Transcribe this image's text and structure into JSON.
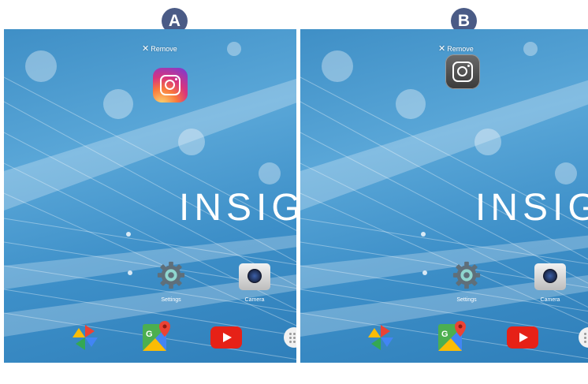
{
  "panels": [
    {
      "badge": "A",
      "remove_label": "Remove",
      "dragged_app_icon": "instagram-icon",
      "dragged_app_state": "color",
      "brand_text": "INSIG",
      "settings_label": "Settings",
      "camera_label": "Camera"
    },
    {
      "badge": "B",
      "remove_label": "Remove",
      "dragged_app_icon": "instagram-icon",
      "dragged_app_state": "grayed",
      "brand_text": "INSIG",
      "settings_label": "Settings",
      "camera_label": "Camera"
    }
  ],
  "dock_icons": [
    "pinwheel-photos-icon",
    "maps-icon",
    "youtube-icon",
    "app-drawer-icon"
  ],
  "colors": {
    "badge": "#4a5b86",
    "wallpaper": "#4a9ad0",
    "youtube_red": "#e62117"
  }
}
